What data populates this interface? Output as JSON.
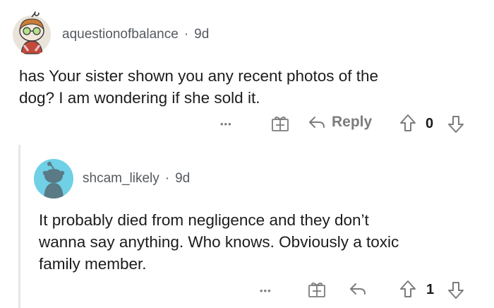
{
  "comments": [
    {
      "username": "aquestionofbalance",
      "age": "9d",
      "body_line1": "has Your sister shown you any recent photos of the",
      "body_line2": "dog?  I am wondering if she sold it.",
      "more": "•••",
      "reply_label": "Reply",
      "score": "0",
      "icons": [
        "avatar",
        "more-icon",
        "award-icon",
        "reply-icon",
        "upvote-icon",
        "downvote-icon"
      ]
    },
    {
      "username": "shcam_likely",
      "age": "9d",
      "body_line1": "It probably died from negligence and they don’t",
      "body_line2": "wanna say anything. Who knows. Obviously a toxic",
      "body_line3": "family member.",
      "more": "•••",
      "score": "1",
      "icons": [
        "avatar",
        "more-icon",
        "award-icon",
        "reply-icon",
        "upvote-icon",
        "downvote-icon"
      ]
    }
  ],
  "meta_separator": "·",
  "colors": {
    "text": "#1c1c1c",
    "muted": "#7c7c7c",
    "username": "#555a60",
    "avatar2_bg": "#6fd0e6",
    "thread_line": "#e6e6e6"
  }
}
